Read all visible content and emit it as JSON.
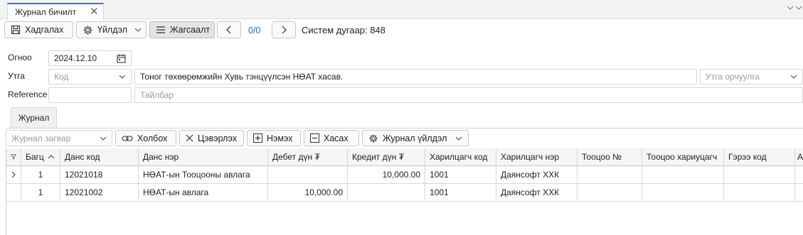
{
  "tab": {
    "title": "Журнал бичилт",
    "close": "✕"
  },
  "toolbar": {
    "save_label": "Хадгалах",
    "actions_label": "Үйлдэл",
    "list_label": "Жагсаалт",
    "counter": "0/0",
    "system_number": "Систем дугаар: 848"
  },
  "form": {
    "date_label": "Огноо",
    "date_value": "2024.12.10",
    "purpose_label": "Утга",
    "code_placeholder": "Код",
    "purpose_value": "Тоног төхөөрөмжийн Хувь тэнцүүлсэн НӨАТ хасав.",
    "translation_placeholder": "Утга орчуулга",
    "reference_label": "Reference",
    "description_placeholder": "Тайлбар"
  },
  "journal": {
    "tab_label": "Журнал",
    "template_placeholder": "Журнал загвар",
    "link_label": "Холбох",
    "clear_label": "Цэвэрлэх",
    "add_label": "Нэмэх",
    "remove_label": "Хасах",
    "actions_label": "Журнал үйлдэл"
  },
  "grid": {
    "columns": [
      "Багц",
      "Данс код",
      "Данс нэр",
      "Дебет дүн ₮",
      "Кредит дүн ₮",
      "Харилцагч код",
      "Харилцагч нэр",
      "Тооцоо №",
      "Тооцоо хариуцагч",
      "Гэрээ код",
      "А"
    ],
    "rows": [
      [
        "1",
        "12021018",
        "НӨАТ-ын Тооцооны авлага",
        "",
        "10,000.00",
        "1001",
        "Даянсофт ХХК",
        "",
        "",
        "",
        ""
      ],
      [
        "1",
        "12021002",
        "НӨАТ-ын авлага",
        "10,000.00",
        "",
        "1001",
        "Даянсофт ХХК",
        "",
        "",
        "",
        ""
      ]
    ]
  }
}
